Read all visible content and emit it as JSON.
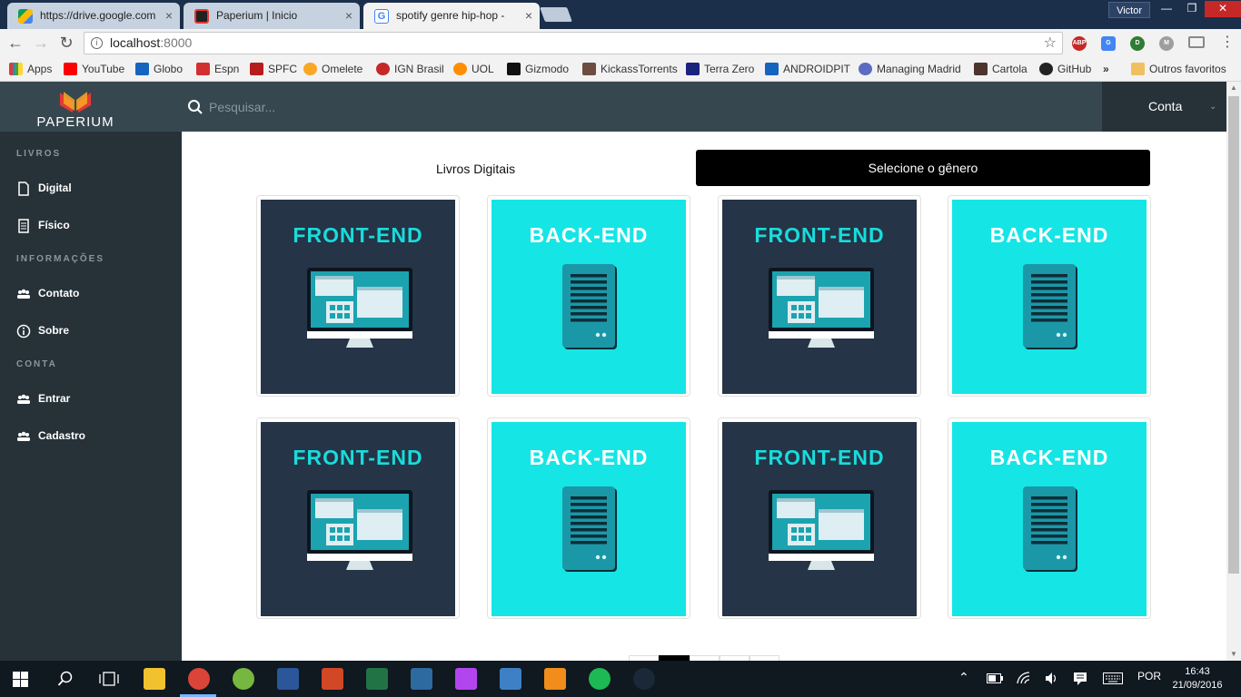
{
  "browser": {
    "tabs": [
      {
        "title": "https://drive.google.com",
        "close": "×"
      },
      {
        "title": "Paperium | Inicio",
        "close": "×"
      },
      {
        "title": "spotify genre hip-hop - ",
        "close": "×"
      }
    ],
    "window_user": "Victor",
    "window_controls": {
      "minimize": "—",
      "maximize": "❐",
      "close": "✕"
    },
    "nav": {
      "back": "←",
      "forward": "→",
      "reload": "↻"
    },
    "url": {
      "host": "localhost",
      "port": ":8000"
    },
    "bookmarks": [
      {
        "label": "Apps",
        "color": "#e53935"
      },
      {
        "label": "YouTube",
        "color": "#ff0000"
      },
      {
        "label": "Globo",
        "color": "#1565c0"
      },
      {
        "label": "Espn",
        "color": "#d32f2f"
      },
      {
        "label": "SPFC",
        "color": "#b71c1c"
      },
      {
        "label": "Omelete",
        "color": "#f9a825"
      },
      {
        "label": "IGN Brasil",
        "color": "#c62828"
      },
      {
        "label": "UOL",
        "color": "#ff8f00"
      },
      {
        "label": "Gizmodo",
        "color": "#111111"
      },
      {
        "label": "KickassTorrents",
        "color": "#6d4c41"
      },
      {
        "label": "Terra Zero",
        "color": "#1a237e"
      },
      {
        "label": "ANDROIDPIT",
        "color": "#1565c0"
      },
      {
        "label": "Managing Madrid",
        "color": "#5c6bc0"
      },
      {
        "label": "Cartola",
        "color": "#4e342e"
      },
      {
        "label": "GitHub",
        "color": "#222222"
      }
    ],
    "more_bookmarks": "»",
    "other_bookmarks": "Outros favoritos"
  },
  "app": {
    "logo_text": "PAPERIUM",
    "search_placeholder": "Pesquisar...",
    "account_label": "Conta",
    "sidebar": {
      "sections": [
        {
          "heading": "LIVROS",
          "items": [
            {
              "label": "Digital",
              "icon": "file-icon"
            },
            {
              "label": "Físico",
              "icon": "document-icon"
            }
          ]
        },
        {
          "heading": "INFORMAÇÕES",
          "items": [
            {
              "label": "Contato",
              "icon": "users-icon"
            },
            {
              "label": "Sobre",
              "icon": "info-icon"
            }
          ]
        },
        {
          "heading": "CONTA",
          "items": [
            {
              "label": "Entrar",
              "icon": "users-icon"
            },
            {
              "label": "Cadastro",
              "icon": "users-icon"
            }
          ]
        }
      ]
    },
    "tab_label": "Livros Digitais",
    "genre_button": "Selecione o gênero",
    "cards": [
      {
        "title": "FRONT-END",
        "kind": "front"
      },
      {
        "title": "BACK-END",
        "kind": "back"
      },
      {
        "title": "FRONT-END",
        "kind": "front"
      },
      {
        "title": "BACK-END",
        "kind": "back"
      },
      {
        "title": "FRONT-END",
        "kind": "front"
      },
      {
        "title": "BACK-END",
        "kind": "back"
      },
      {
        "title": "FRONT-END",
        "kind": "front"
      },
      {
        "title": "BACK-END",
        "kind": "back"
      }
    ]
  },
  "taskbar": {
    "apps": [
      {
        "name": "file-explorer-icon",
        "color": "#f2c12e"
      },
      {
        "name": "chrome-icon",
        "color": "#db4437"
      },
      {
        "name": "utorrent-icon",
        "color": "#76b83f"
      },
      {
        "name": "word-icon",
        "color": "#2b579a"
      },
      {
        "name": "powerpoint-icon",
        "color": "#d24726"
      },
      {
        "name": "excel-icon",
        "color": "#217346"
      },
      {
        "name": "mysql-workbench-icon",
        "color": "#2d6a9f"
      },
      {
        "name": "phpstorm-icon",
        "color": "#b345f1"
      },
      {
        "name": "virtualbox-icon",
        "color": "#3d80c6"
      },
      {
        "name": "vlc-icon",
        "color": "#f28c1a"
      },
      {
        "name": "spotify-icon",
        "color": "#1db954"
      },
      {
        "name": "steam-icon",
        "color": "#1b2838"
      }
    ],
    "language": "POR",
    "time": "16:43",
    "date": "21/09/2016"
  },
  "colors": {
    "sidebar_bg": "#263238",
    "topbar_bg": "#37474f",
    "front_tile": "#253446",
    "back_tile": "#16e5e5",
    "accent_cyan": "#19dcdc"
  }
}
